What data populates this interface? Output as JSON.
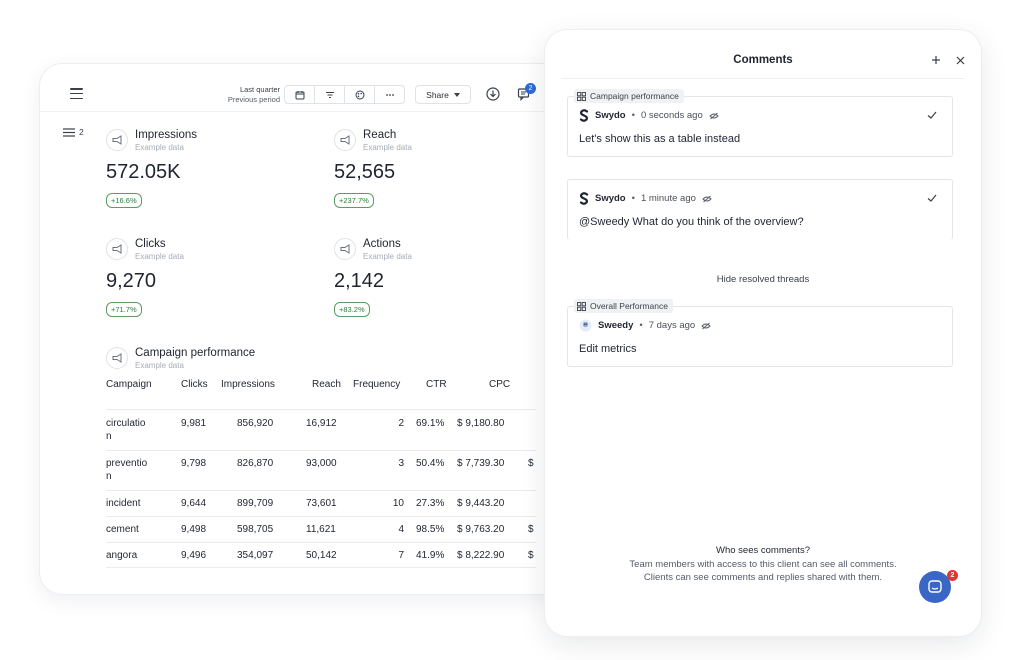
{
  "dashboard": {
    "period_label": "Last quarter",
    "period_sub": "Previous period",
    "share_label": "Share",
    "notification_count": "2",
    "list_count": "2",
    "kpis": [
      {
        "title": "Impressions",
        "sub": "Example data",
        "value": "572.05K",
        "change": "+16.6%"
      },
      {
        "title": "Reach",
        "sub": "Example data",
        "value": "52,565",
        "change": "+237.7%"
      },
      {
        "title": "Clicks",
        "sub": "Example data",
        "value": "9,270",
        "change": "+71.7%"
      },
      {
        "title": "Actions",
        "sub": "Example data",
        "value": "2,142",
        "change": "+83.2%"
      }
    ],
    "table": {
      "title": "Campaign performance",
      "sub": "Example data",
      "headers": [
        "Campaign",
        "Clicks",
        "Impressions",
        "Reach",
        "Frequency",
        "CTR",
        "CPC"
      ],
      "rows": [
        {
          "campaign": "circulatio",
          "campaign2": "n",
          "clicks": "9,981",
          "impressions": "856,920",
          "reach": "16,912",
          "frequency": "2",
          "ctr": "69.1%",
          "cpc": "$ 9,180.80",
          "extra": ""
        },
        {
          "campaign": "preventio",
          "campaign2": "n",
          "clicks": "9,798",
          "impressions": "826,870",
          "reach": "93,000",
          "frequency": "3",
          "ctr": "50.4%",
          "cpc": "$ 7,739.30",
          "extra": "$"
        },
        {
          "campaign": "incident",
          "campaign2": "",
          "clicks": "9,644",
          "impressions": "899,709",
          "reach": "73,601",
          "frequency": "10",
          "ctr": "27.3%",
          "cpc": "$ 9,443.20",
          "extra": ""
        },
        {
          "campaign": "cement",
          "campaign2": "",
          "clicks": "9,498",
          "impressions": "598,705",
          "reach": "11,621",
          "frequency": "4",
          "ctr": "98.5%",
          "cpc": "$ 9,763.20",
          "extra": "$"
        },
        {
          "campaign": "angora",
          "campaign2": "",
          "clicks": "9,496",
          "impressions": "354,097",
          "reach": "50,142",
          "frequency": "7",
          "ctr": "41.9%",
          "cpc": "$ 8,222.90",
          "extra": "$"
        }
      ]
    }
  },
  "comments": {
    "title": "Comments",
    "threads": [
      {
        "tag": "Campaign performance",
        "author": "Swydo",
        "time": "0 seconds ago",
        "text": "Let's show this as a table instead"
      },
      {
        "tag": "",
        "author": "Swydo",
        "time": "1 minute ago",
        "mention": "@Sweedy",
        "text": "What do you think of the overview?"
      },
      {
        "tag": "Overall Performance",
        "author": "Sweedy",
        "time": "7 days ago",
        "text": "Edit metrics"
      }
    ],
    "separator": "•",
    "hide_resolved": "Hide resolved threads",
    "who_title": "Who sees comments?",
    "who_line1": "Team members with access to this client can see all comments.",
    "who_line2": "Clients can see comments and replies shared with them.",
    "chat_badge": "2"
  },
  "colors": {
    "accent_blue": "#2d6ad8",
    "chat_blue": "#3a66c4",
    "badge_red": "#e13636",
    "positive_green": "#2f7a3a"
  }
}
